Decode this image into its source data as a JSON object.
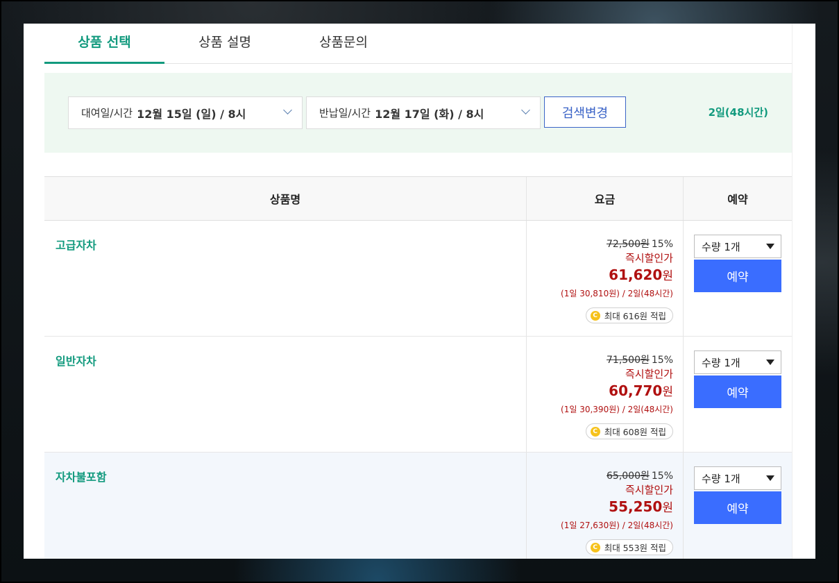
{
  "tabs": [
    {
      "label": "상품 선택",
      "active": true
    },
    {
      "label": "상품 설명",
      "active": false
    },
    {
      "label": "상품문의",
      "active": false
    }
  ],
  "search": {
    "pickup": {
      "label": "대여일/시간",
      "value": "12월 15일 (일) / 8시"
    },
    "return": {
      "label": "반납일/시간",
      "value": "12월 17일 (화) / 8시"
    },
    "button_label": "검색변경",
    "duration": "2일(48시간)"
  },
  "table": {
    "headers": [
      "상품명",
      "요금",
      "예약"
    ],
    "rows": [
      {
        "name": "고급자차",
        "original_price": "72,500원",
        "discount_rate": "15%",
        "discount_label": "즉시할인가",
        "price": "61,620",
        "currency": "원",
        "per_day": "(1일 30,810원) / 2일(48시간)",
        "points": "최대 616원 적립",
        "qty_label": "수량 1개",
        "book_label": "예약"
      },
      {
        "name": "일반자차",
        "original_price": "71,500원",
        "discount_rate": "15%",
        "discount_label": "즉시할인가",
        "price": "60,770",
        "currency": "원",
        "per_day": "(1일 30,390원) / 2일(48시간)",
        "points": "최대 608원 적립",
        "qty_label": "수량 1개",
        "book_label": "예약"
      },
      {
        "name": "자차불포함",
        "original_price": "65,000원",
        "discount_rate": "15%",
        "discount_label": "즉시할인가",
        "price": "55,250",
        "currency": "원",
        "per_day": "(1일 27,630원) / 2일(48시간)",
        "points": "최대 553원 적립",
        "qty_label": "수량 1개",
        "book_label": "예약"
      }
    ]
  },
  "icons": {
    "coin_glyph": "C",
    "coin_color": "#f6c21c"
  },
  "colors": {
    "accent_green": "#129a7e",
    "price_red": "#b01010",
    "book_blue": "#3a6dff"
  }
}
